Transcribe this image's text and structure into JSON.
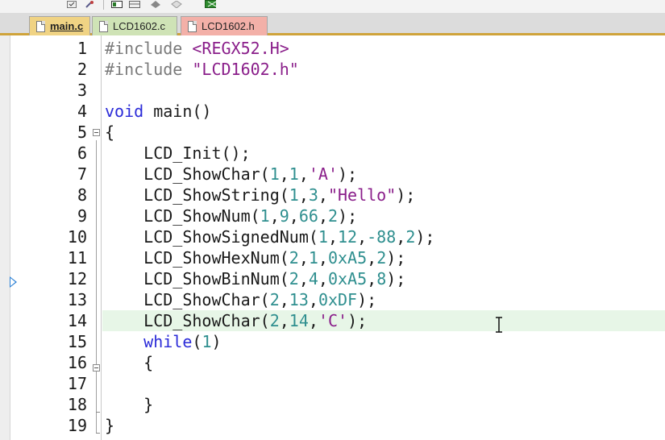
{
  "tabs": [
    {
      "label": "main.c",
      "kind": "active"
    },
    {
      "label": "LCD1602.c",
      "kind": "c"
    },
    {
      "label": "LCD1602.h",
      "kind": "h"
    }
  ],
  "editor": {
    "current_line": 14,
    "execution_marker_line": 12,
    "colors": {
      "preprocessor": "#7a7a7a",
      "keyword": "#2b2bd8",
      "number": "#2f8f8f",
      "string": "#8a1e8a",
      "default": "#1a1a1a",
      "current_line_bg": "#e7f6e7"
    },
    "lines": [
      {
        "n": "1",
        "tokens": [
          {
            "t": "#include ",
            "c": "preprocessor"
          },
          {
            "t": "<REGX52.H>",
            "c": "string"
          }
        ]
      },
      {
        "n": "2",
        "tokens": [
          {
            "t": "#include ",
            "c": "preprocessor"
          },
          {
            "t": "\"LCD1602.h\"",
            "c": "string"
          }
        ]
      },
      {
        "n": "3",
        "tokens": []
      },
      {
        "n": "4",
        "tokens": [
          {
            "t": "void",
            "c": "keyword"
          },
          {
            "t": " main()",
            "c": "default"
          }
        ]
      },
      {
        "n": "5",
        "tokens": [
          {
            "t": "{",
            "c": "default"
          }
        ]
      },
      {
        "n": "6",
        "tokens": [
          {
            "t": "    LCD_Init();",
            "c": "default"
          }
        ]
      },
      {
        "n": "7",
        "tokens": [
          {
            "t": "    LCD_ShowChar(",
            "c": "default"
          },
          {
            "t": "1",
            "c": "number"
          },
          {
            "t": ",",
            "c": "default"
          },
          {
            "t": "1",
            "c": "number"
          },
          {
            "t": ",",
            "c": "default"
          },
          {
            "t": "'A'",
            "c": "string"
          },
          {
            "t": ");",
            "c": "default"
          }
        ]
      },
      {
        "n": "8",
        "tokens": [
          {
            "t": "    LCD_ShowString(",
            "c": "default"
          },
          {
            "t": "1",
            "c": "number"
          },
          {
            "t": ",",
            "c": "default"
          },
          {
            "t": "3",
            "c": "number"
          },
          {
            "t": ",",
            "c": "default"
          },
          {
            "t": "\"Hello\"",
            "c": "string"
          },
          {
            "t": ");",
            "c": "default"
          }
        ]
      },
      {
        "n": "9",
        "tokens": [
          {
            "t": "    LCD_ShowNum(",
            "c": "default"
          },
          {
            "t": "1",
            "c": "number"
          },
          {
            "t": ",",
            "c": "default"
          },
          {
            "t": "9",
            "c": "number"
          },
          {
            "t": ",",
            "c": "default"
          },
          {
            "t": "66",
            "c": "number"
          },
          {
            "t": ",",
            "c": "default"
          },
          {
            "t": "2",
            "c": "number"
          },
          {
            "t": ");",
            "c": "default"
          }
        ]
      },
      {
        "n": "10",
        "tokens": [
          {
            "t": "    LCD_ShowSignedNum(",
            "c": "default"
          },
          {
            "t": "1",
            "c": "number"
          },
          {
            "t": ",",
            "c": "default"
          },
          {
            "t": "12",
            "c": "number"
          },
          {
            "t": ",",
            "c": "default"
          },
          {
            "t": "-88",
            "c": "number"
          },
          {
            "t": ",",
            "c": "default"
          },
          {
            "t": "2",
            "c": "number"
          },
          {
            "t": ");",
            "c": "default"
          }
        ]
      },
      {
        "n": "11",
        "tokens": [
          {
            "t": "    LCD_ShowHexNum(",
            "c": "default"
          },
          {
            "t": "2",
            "c": "number"
          },
          {
            "t": ",",
            "c": "default"
          },
          {
            "t": "1",
            "c": "number"
          },
          {
            "t": ",",
            "c": "default"
          },
          {
            "t": "0xA5",
            "c": "number"
          },
          {
            "t": ",",
            "c": "default"
          },
          {
            "t": "2",
            "c": "number"
          },
          {
            "t": ");",
            "c": "default"
          }
        ]
      },
      {
        "n": "12",
        "tokens": [
          {
            "t": "    LCD_ShowBinNum(",
            "c": "default"
          },
          {
            "t": "2",
            "c": "number"
          },
          {
            "t": ",",
            "c": "default"
          },
          {
            "t": "4",
            "c": "number"
          },
          {
            "t": ",",
            "c": "default"
          },
          {
            "t": "0xA5",
            "c": "number"
          },
          {
            "t": ",",
            "c": "default"
          },
          {
            "t": "8",
            "c": "number"
          },
          {
            "t": ");",
            "c": "default"
          }
        ]
      },
      {
        "n": "13",
        "tokens": [
          {
            "t": "    LCD_ShowChar(",
            "c": "default"
          },
          {
            "t": "2",
            "c": "number"
          },
          {
            "t": ",",
            "c": "default"
          },
          {
            "t": "13",
            "c": "number"
          },
          {
            "t": ",",
            "c": "default"
          },
          {
            "t": "0xDF",
            "c": "number"
          },
          {
            "t": ");",
            "c": "default"
          }
        ]
      },
      {
        "n": "14",
        "tokens": [
          {
            "t": "    LCD_ShowChar(",
            "c": "default"
          },
          {
            "t": "2",
            "c": "number"
          },
          {
            "t": ",",
            "c": "default"
          },
          {
            "t": "14",
            "c": "number"
          },
          {
            "t": ",",
            "c": "default"
          },
          {
            "t": "'C'",
            "c": "string"
          },
          {
            "t": ");",
            "c": "default"
          }
        ]
      },
      {
        "n": "15",
        "tokens": [
          {
            "t": "    ",
            "c": "default"
          },
          {
            "t": "while",
            "c": "keyword"
          },
          {
            "t": "(",
            "c": "default"
          },
          {
            "t": "1",
            "c": "number"
          },
          {
            "t": ")",
            "c": "default"
          }
        ]
      },
      {
        "n": "16",
        "tokens": [
          {
            "t": "    {",
            "c": "default"
          }
        ]
      },
      {
        "n": "17",
        "tokens": []
      },
      {
        "n": "18",
        "tokens": [
          {
            "t": "    }",
            "c": "default"
          }
        ]
      },
      {
        "n": "19",
        "tokens": [
          {
            "t": "}",
            "c": "default"
          }
        ]
      }
    ]
  }
}
